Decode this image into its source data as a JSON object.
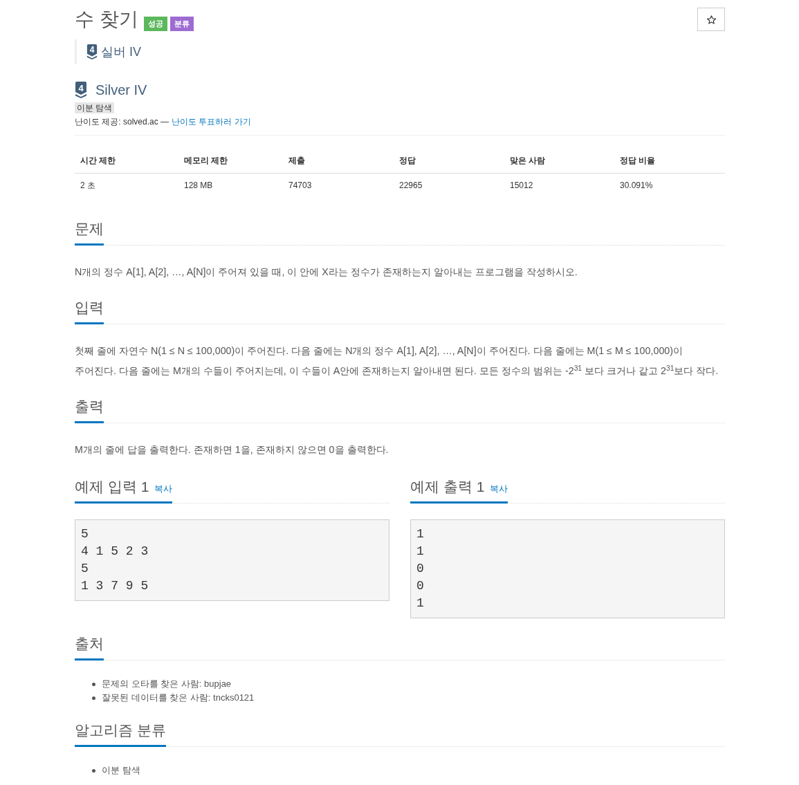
{
  "title": {
    "text": "수 찾기",
    "badges": [
      {
        "label": "성공",
        "color": "#5cb85c"
      },
      {
        "label": "분류",
        "color": "#9d6cd2"
      }
    ]
  },
  "tier_quote": {
    "tier_number": "4",
    "text": "실버 IV"
  },
  "tier": {
    "tier_number": "4",
    "name": "Silver IV",
    "tags": [
      "이분 탐색"
    ],
    "credit": "난이도 제공: solved.ac —",
    "credit_link": "난이도 투표하러 가기"
  },
  "stats_table": {
    "columns": [
      "시간 제한",
      "메모리 제한",
      "제출",
      "정답",
      "맞은 사람",
      "정답 비율"
    ],
    "rows": [
      [
        "2 초",
        "128 MB",
        "74703",
        "22965",
        "15012",
        "30.091%"
      ]
    ]
  },
  "sections": [
    {
      "kind": "text",
      "heading": "문제",
      "paragraphs": [
        "N개의 정수 A[1], A[2], …, A[N]이 주어져 있을 때, 이 안에 X라는 정수가 존재하는지 알아내는 프로그램을 작성하시오."
      ]
    },
    {
      "kind": "text",
      "heading": "입력",
      "paragraphs": [
        "첫째 줄에 자연수 N(1 ≤ N ≤ 100,000)이 주어진다. 다음 줄에는 N개의 정수 A[1], A[2], …, A[N]이 주어진다. 다음 줄에는 M(1 ≤ M ≤ 100,000)이 주어진다. 다음 줄에는 M개의 수들이 주어지는데, 이 수들이 A안에 존재하는지 알아내면 된다. 모든 정수의 범위는 -2$^{31}$ 보다 크거나 같고 2$^{31}$보다 작다."
      ]
    },
    {
      "kind": "text",
      "heading": "출력",
      "paragraphs": [
        "M개의 줄에 답을 출력한다. 존재하면 1을, 존재하지 않으면 0을 출력한다."
      ]
    },
    {
      "kind": "samples",
      "samples": [
        {
          "heading": "예제 입력 1",
          "copy_label": "복사",
          "lines": [
            "5",
            "4 1 5 2 3",
            "5",
            "1 3 7 9 5"
          ]
        },
        {
          "heading": "예제 출력 1",
          "copy_label": "복사",
          "lines": [
            "1",
            "1",
            "0",
            "0",
            "1"
          ]
        }
      ]
    },
    {
      "kind": "list",
      "heading": "출처",
      "items": [
        "문제의 오타를 찾은 사람: bupjae",
        "잘못된 데이터를 찾은 사람: tncks0121"
      ]
    },
    {
      "kind": "list",
      "heading": "알고리즘 분류",
      "items": [
        "이분 탐색"
      ]
    }
  ]
}
